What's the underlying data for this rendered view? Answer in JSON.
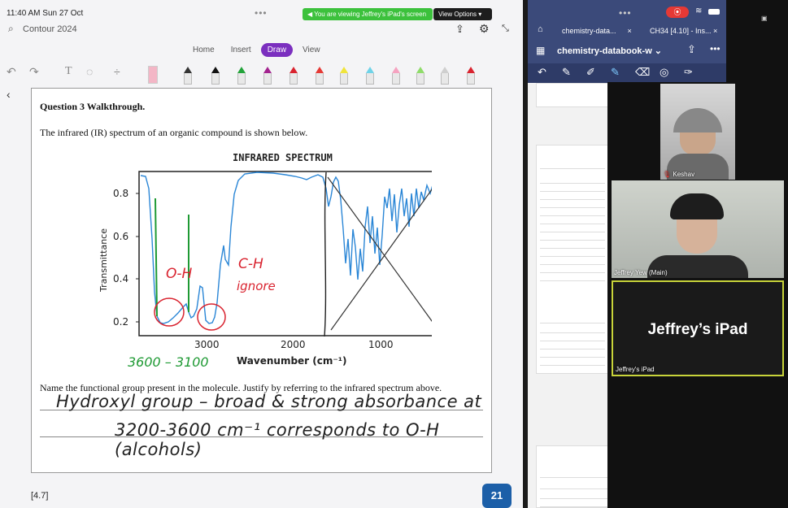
{
  "status": {
    "time": "11:40 AM  Sun 27 Oct",
    "banner": "You are viewing Jeffrey's iPad's screen",
    "view_options": "View Options"
  },
  "app": {
    "title": "Contour 2024",
    "tabs": [
      {
        "label": "Home"
      },
      {
        "label": "Insert"
      },
      {
        "label": "Draw",
        "active": true
      },
      {
        "label": "View"
      }
    ],
    "accent": "#7b2fbf"
  },
  "page": {
    "question_title": "Question 3 Walkthrough.",
    "intro": "The infrared (IR) spectrum of an organic compound is shown below.",
    "prompt": "Name the functional group present in the molecule. Justify by referring to the infrared spectrum above.",
    "answer_line1": "Hydroxyl group  –  broad & strong absorbance at",
    "answer_line2": "3200-3600 cm⁻¹ corresponds to O-H (alcohols)",
    "mark_ref": "[4.7]",
    "page_badge": "21"
  },
  "spectrum": {
    "title": "INFRARED SPECTRUM",
    "ylabel": "Transmittance",
    "xlabel": "Wavenumber (cm⁻¹)",
    "y_ticks": [
      "0.8",
      "0.6",
      "0.4",
      "0.2"
    ],
    "x_ticks": [
      "3000",
      "2000",
      "1000"
    ],
    "annotation_oh": "O-H",
    "annotation_ch": "C-H",
    "annotation_ignore": "ignore",
    "range_note": "3600 – 3100"
  },
  "browser": {
    "tab1": "chemistry-data...",
    "tab2": "CH34 [4.10] - Ins...",
    "doc_title": "chemistry-databook-w"
  },
  "zoom": {
    "participant1": "Keshav",
    "participant2": "Jeffrey Yew (Main)",
    "ipad_tile": "Jeffrey’s iPad",
    "ipad_name": "Jeffrey's iPad"
  }
}
